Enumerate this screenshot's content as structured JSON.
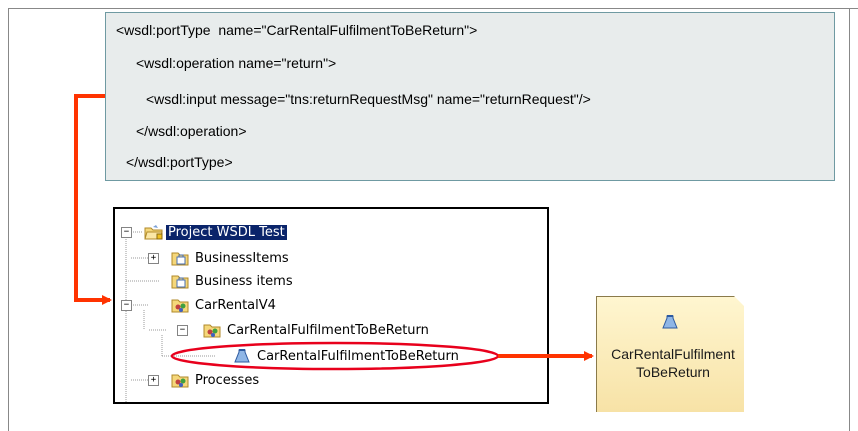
{
  "code": {
    "lines": [
      "<wsdl:portType  name=\"CarRentalFulfilmentToBeReturn\">",
      "<wsdl:operation name=\"return\">",
      "<wsdl:input message=\"tns:returnRequestMsg\" name=\"returnRequest\"/>",
      "</wsdl:operation>",
      "</wsdl:portType>"
    ]
  },
  "tree": {
    "items": [
      {
        "label": "Project WSDL Test",
        "icon": "project-folder-icon",
        "selected": true,
        "expander": "−"
      },
      {
        "label": "BusinessItems",
        "icon": "business-items-folder-icon",
        "selected": false,
        "expander": "+"
      },
      {
        "label": "Business items",
        "icon": "business-items-folder-icon",
        "selected": false,
        "expander": ""
      },
      {
        "label": "CarRentalV4",
        "icon": "process-catalog-icon",
        "selected": false,
        "expander": "−"
      },
      {
        "label": "CarRentalFulfilmentToBeReturn",
        "icon": "process-catalog-icon",
        "selected": false,
        "expander": "−"
      },
      {
        "label": "CarRentalFulfilmentToBeReturn",
        "icon": "service-icon",
        "selected": false,
        "expander": ""
      },
      {
        "label": "Processes",
        "icon": "process-catalog-icon",
        "selected": false,
        "expander": "+"
      }
    ]
  },
  "result": {
    "line1": "CarRentalFulfilment",
    "line2": "ToBeReturn",
    "icon": "service-icon"
  },
  "colors": {
    "arrow": "#ff3300",
    "highlight_ellipse": "#e8001c",
    "selection": "#0a246a"
  }
}
